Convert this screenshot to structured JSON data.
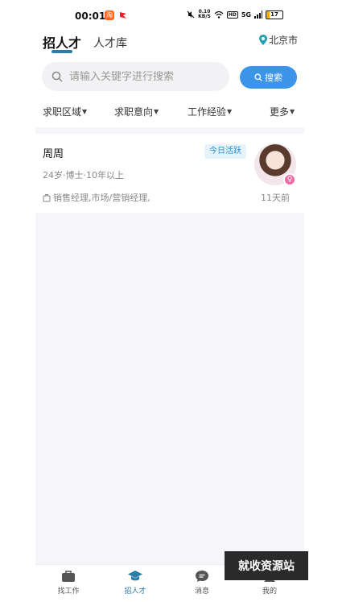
{
  "status_bar": {
    "time": "00:01",
    "speed_top": "0.10",
    "speed_unit": "KB/S",
    "network": "5G",
    "battery": "17"
  },
  "header": {
    "tabs": [
      {
        "label": "招人才",
        "active": true
      },
      {
        "label": "人才库",
        "active": false
      }
    ],
    "city": "北京市"
  },
  "search": {
    "placeholder": "请输入关键字进行搜索",
    "button_label": "搜索"
  },
  "filters": [
    {
      "label": "求职区域"
    },
    {
      "label": "求职意向"
    },
    {
      "label": "工作经验"
    },
    {
      "label": "更多"
    }
  ],
  "candidates": [
    {
      "name": "周周",
      "badge": "今日活跃",
      "meta": "24岁·博士·10年以上",
      "job": "销售经理,市场/营销经理,",
      "last_active": "11天前",
      "gender_color": "#ef6aa0"
    }
  ],
  "bottom_nav": [
    {
      "label": "找工作",
      "icon": "briefcase-icon",
      "active": false
    },
    {
      "label": "招人才",
      "icon": "graduation-cap-icon",
      "active": true
    },
    {
      "label": "消息",
      "icon": "chat-bubble-icon",
      "active": false
    },
    {
      "label": "我的",
      "icon": "person-icon",
      "active": false
    }
  ],
  "watermark": "就收资源站",
  "colors": {
    "accent": "#2a7da8",
    "search_button": "#3c95e8",
    "badge_bg": "#e6f3fb",
    "badge_text": "#2b8fcf"
  }
}
